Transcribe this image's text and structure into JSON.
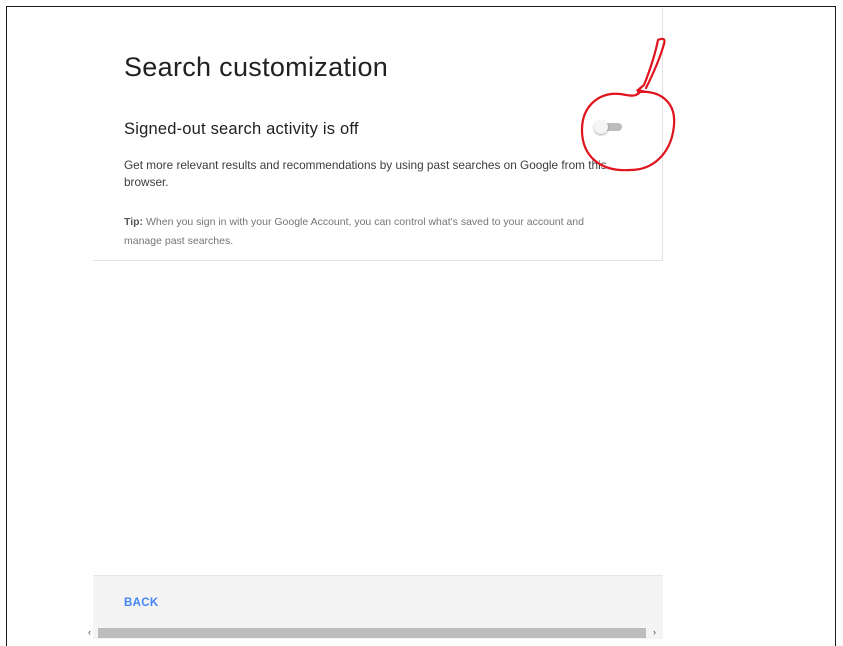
{
  "page": {
    "title": "Search customization",
    "setting_title": "Signed-out search activity is off",
    "description": "Get more relevant results and recommendations by using past searches on Google from this browser.",
    "tip_label": "Tip:",
    "tip_text": " When you sign in with your Google Account, you can control what's saved to your account and manage past searches."
  },
  "toggle": {
    "state": "off"
  },
  "footer": {
    "back_label": "BACK"
  },
  "scrollbar": {
    "left_arrow": "‹",
    "right_arrow": "›"
  },
  "colors": {
    "accent": "#4285f4",
    "annotation": "#e0141e"
  }
}
